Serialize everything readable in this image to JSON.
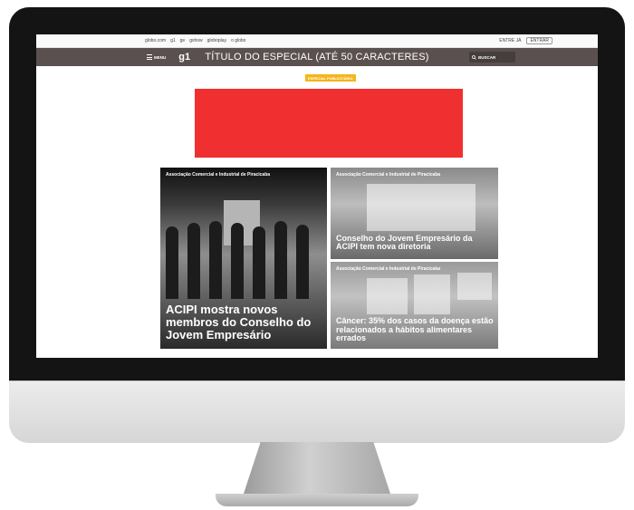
{
  "topbar": {
    "links": [
      "globo.com",
      "g1",
      "ge",
      "gshow",
      "globoplay",
      "o globo"
    ],
    "login_hint": "ENTRE JÁ",
    "login_button": "ENTRAR"
  },
  "header": {
    "menu_label": "MENU",
    "logo": "g1",
    "title": "TÍTULO DO ESPECIAL (ATÉ 50 CARACTERES)",
    "search_label": "BUSCAR"
  },
  "badge": "ESPECIAL PUBLICITÁRIO",
  "colors": {
    "header_bg": "#5b5050",
    "badge_bg": "#f4b61a",
    "ad_bg": "#f03030"
  },
  "cards": [
    {
      "label": "Associação Comercial e Industrial de Piracicaba",
      "headline": "ACIPI mostra novos membros do Conselho do Jovem Empresário"
    },
    {
      "label": "Associação Comercial e Industrial de Piracicaba",
      "headline": "Conselho do Jovem Empresário da ACIPI tem nova diretoria"
    },
    {
      "label": "Associação Comercial e Industrial de Piracicaba",
      "headline": "Câncer: 35% dos casos da doença estão relacionados a hábitos alimentares errados"
    }
  ]
}
